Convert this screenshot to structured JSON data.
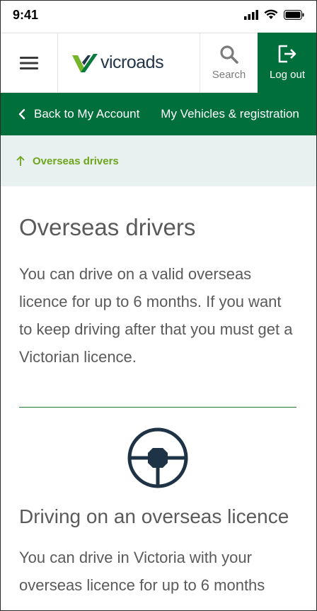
{
  "status_bar": {
    "time": "9:41"
  },
  "header": {
    "logo_text": "vicroads",
    "search_label": "Search",
    "logout_label": "Log out"
  },
  "subnav": {
    "back_label": "Back to My Account",
    "vehicles_label": "My Vehicles & registration"
  },
  "breadcrumb": {
    "label": "Overseas drivers"
  },
  "main": {
    "title": "Overseas drivers",
    "intro": "You can drive on a valid overseas licence for up to 6 months. If you want to keep driving after that you must get a Victorian licence.",
    "section_title": "Driving on an overseas licence",
    "section_text": "You can drive in Victoria with your overseas licence for up to 6 months"
  },
  "colors": {
    "brand_green": "#006f3b",
    "breadcrumb_green": "#6ea51d",
    "breadcrumb_bg": "#e9f1f0",
    "icon_navy": "#1f3346"
  },
  "icons": [
    "hamburger-menu-icon",
    "vicroads-logo-icon",
    "search-icon",
    "logout-icon",
    "chevron-left-icon",
    "arrow-up-icon",
    "steering-wheel-icon",
    "signal-icon",
    "wifi-icon",
    "battery-icon"
  ]
}
